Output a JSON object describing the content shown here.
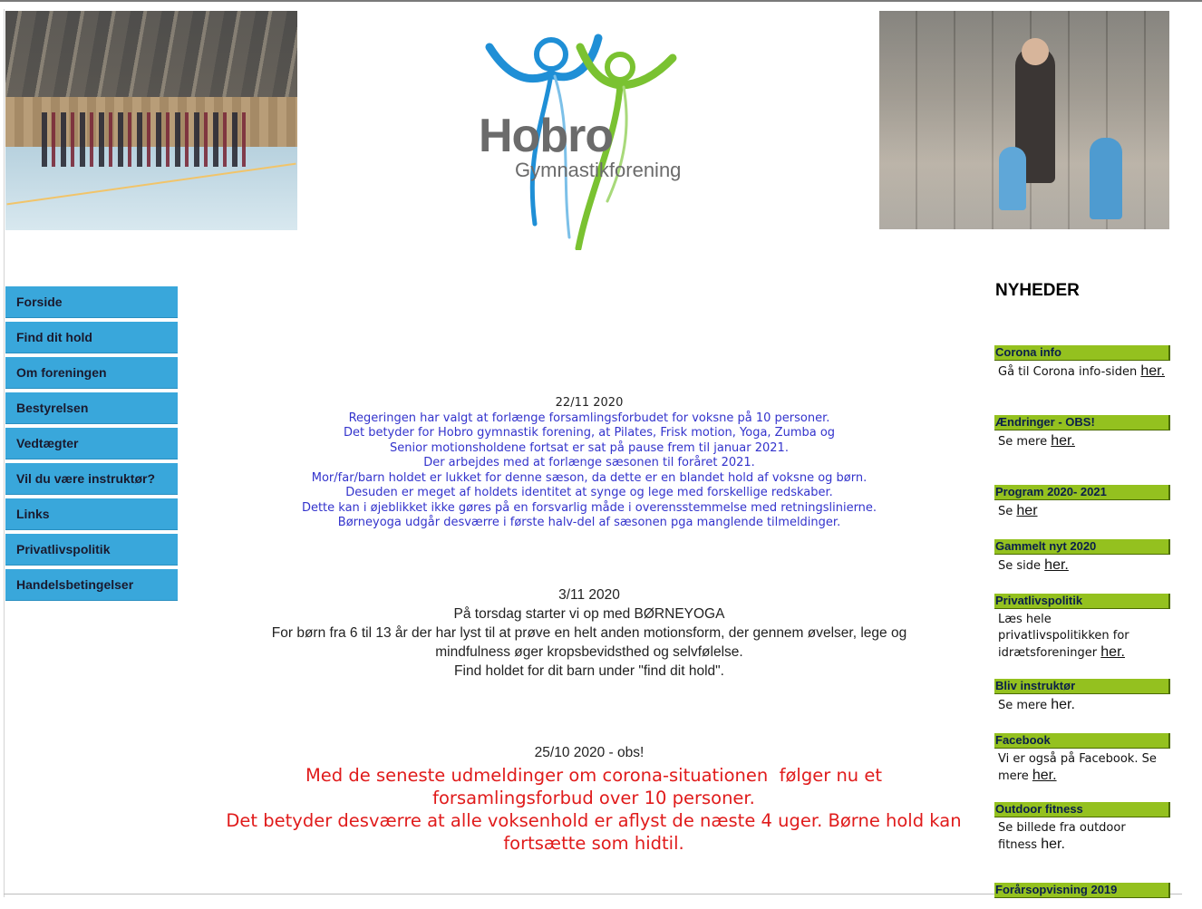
{
  "nav": {
    "items": [
      {
        "label": "Forside"
      },
      {
        "label": "Find dit hold"
      },
      {
        "label": "Om foreningen"
      },
      {
        "label": "Bestyrelsen"
      },
      {
        "label": "Vedtægter"
      },
      {
        "label": "Vil du være instruktør?"
      },
      {
        "label": "Links"
      },
      {
        "label": "Privatlivspolitik"
      },
      {
        "label": "Handelsbetingelser"
      }
    ]
  },
  "logo": {
    "main": "Hobro",
    "sub": "Gymnastikforening"
  },
  "news": [
    {
      "date": "22/11 2020",
      "lines": [
        "Regeringen har valgt at forlænge forsamlingsforbudet for voksne på 10 personer.",
        "Det betyder for Hobro gymnastik forening, at Pilates, Frisk motion, Yoga, Zumba og",
        "Senior motionsholdene fortsat er sat på pause frem til januar 2021.",
        "Der arbejdes med at forlænge sæsonen til foråret 2021.",
        "Mor/far/barn holdet er lukket for denne sæson, da dette er en blandet hold af voksne og børn.",
        "Desuden er meget af holdets identitet at synge og lege med forskellige redskaber.",
        "Dette kan i øjeblikket ikke gøres på en forsvarlig måde i overensstemmelse med retningslinierne.",
        "Børneyoga udgår desværre i første halv-del af sæsonen pga manglende tilmeldinger."
      ]
    },
    {
      "date": "3/11 2020",
      "lines": [
        "På torsdag starter vi op med BØRNEYOGA",
        "For børn fra 6 til 13 år der har lyst til at prøve en helt anden motionsform, der gennem øvelser, lege og",
        "mindfulness øger kropsbevidsthed og selvfølelse.",
        "Find holdet for dit barn under \"find dit hold\"."
      ]
    },
    {
      "date": "25/10 2020 - obs!",
      "lines": [
        "Med de seneste udmeldinger om corona-situationen  følger nu et",
        "forsamlingsforbud over 10 personer.",
        "Det betyder desværre at alle voksenhold er aflyst de næste 4 uger. Børne hold kan",
        "fortsætte som hidtil."
      ]
    }
  ],
  "sidebar": {
    "title": "NYHEDER",
    "blocks": [
      {
        "head": "Corona info",
        "text": "Gå til Corona info-siden",
        "link": "her."
      },
      {
        "head": "Ændringer - OBS!",
        "text": "Se mere",
        "link": "her."
      },
      {
        "head": "Program 2020- 2021",
        "text": "Se",
        "link": "her"
      },
      {
        "head": "Gammelt nyt 2020",
        "text": "Se side",
        "link": "her."
      },
      {
        "head": "Privatlivspolitik",
        "text": "Læs hele privatlivspolitikken for idrætsforeninger",
        "link": "her."
      },
      {
        "head": "Bliv instruktør",
        "text": "Se mere",
        "link": "her."
      },
      {
        "head": "Facebook",
        "text": "Vi er også på Facebook. Se mere",
        "link": "her."
      },
      {
        "head": "Outdoor fitness",
        "text": "Se billede fra outdoor fitness",
        "link": "her."
      },
      {
        "head": "Forårsopvisning 2019",
        "text": "",
        "link": ""
      }
    ]
  }
}
